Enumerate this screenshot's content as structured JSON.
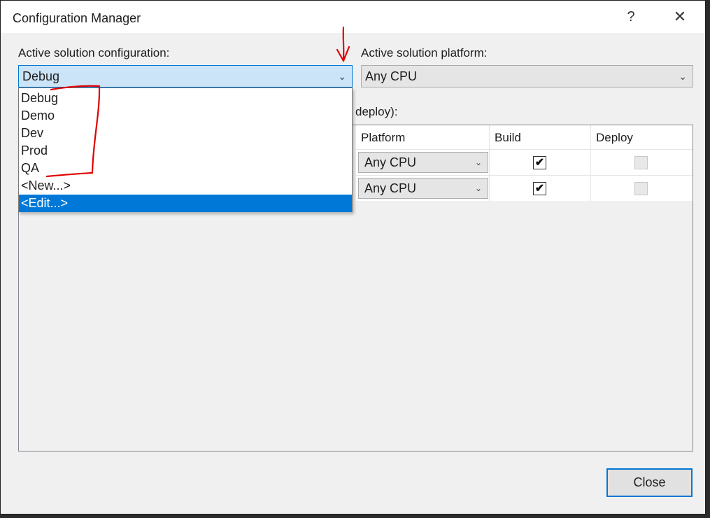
{
  "window": {
    "title": "Configuration Manager",
    "help_glyph": "?",
    "close_glyph": "✕"
  },
  "config": {
    "label": "Active solution configuration:",
    "selected": "Debug",
    "options": [
      "Debug",
      "Demo",
      "Dev",
      "Prod",
      "QA",
      "<New...>",
      "<Edit...>"
    ],
    "highlighted_option": "<Edit...>"
  },
  "platform": {
    "label": "Active solution platform:",
    "selected": "Any CPU"
  },
  "contexts": {
    "partial_label": "deploy):",
    "columns": {
      "platform": "Platform",
      "build": "Build",
      "deploy": "Deploy"
    },
    "rows": [
      {
        "platform": "Any CPU",
        "build": true,
        "deploy": false
      },
      {
        "platform": "Any CPU",
        "build": true,
        "deploy": false
      }
    ]
  },
  "buttons": {
    "close": "Close"
  },
  "icons": {
    "chevron": "chevron-down-icon",
    "checkmark": "✔"
  },
  "colors": {
    "accent": "#0078d7",
    "annotation": "#e00000"
  }
}
